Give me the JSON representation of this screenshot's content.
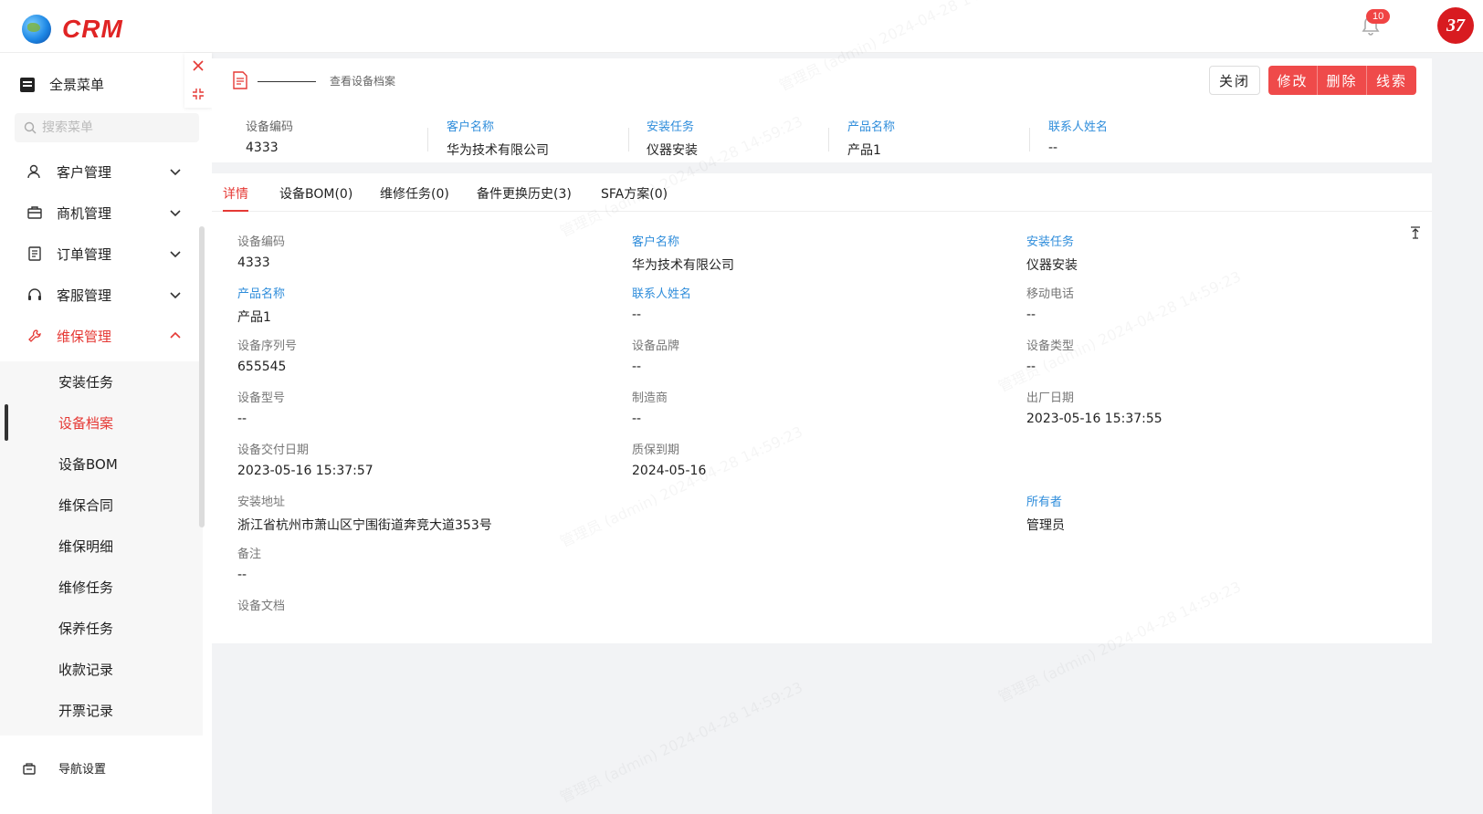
{
  "app": {
    "logo_text": "CRM",
    "notification_count": "10",
    "avatar_text": "37"
  },
  "sidebar": {
    "full_menu_label": "全景菜单",
    "search_placeholder": "搜索菜单",
    "items": [
      {
        "label": "客户管理",
        "icon": "user-icon"
      },
      {
        "label": "商机管理",
        "icon": "briefcase-icon"
      },
      {
        "label": "订单管理",
        "icon": "document-icon"
      },
      {
        "label": "客服管理",
        "icon": "headset-icon"
      },
      {
        "label": "维保管理",
        "icon": "wrench-icon",
        "active": true
      }
    ],
    "submenu": [
      "安装任务",
      "设备档案",
      "设备BOM",
      "维保合同",
      "维保明细",
      "维修任务",
      "保养任务",
      "收款记录",
      "开票记录"
    ],
    "active_sub": "设备档案",
    "settings_label": "导航设置"
  },
  "header": {
    "title": "查看设备档案",
    "buttons": {
      "close": "关闭",
      "edit": "修改",
      "delete": "删除",
      "lead": "线索"
    }
  },
  "summary": [
    {
      "label": "设备编码",
      "value": "4333"
    },
    {
      "label": "客户名称",
      "value": "华为技术有限公司"
    },
    {
      "label": "安装任务",
      "value": "仪器安装"
    },
    {
      "label": "产品名称",
      "value": "产品1"
    },
    {
      "label": "联系人姓名",
      "value": "--"
    }
  ],
  "tabs": [
    "详情",
    "设备BOM(0)",
    "维修任务(0)",
    "备件更换历史(3)",
    "SFA方案(0)"
  ],
  "details": {
    "device_code": {
      "label": "设备编码",
      "value": "4333"
    },
    "customer": {
      "label": "客户名称",
      "value": "华为技术有限公司"
    },
    "install_task": {
      "label": "安装任务",
      "value": "仪器安装"
    },
    "product": {
      "label": "产品名称",
      "value": "产品1"
    },
    "contact": {
      "label": "联系人姓名",
      "value": "--"
    },
    "mobile": {
      "label": "移动电话",
      "value": "--"
    },
    "serial": {
      "label": "设备序列号",
      "value": "655545"
    },
    "brand": {
      "label": "设备品牌",
      "value": "--"
    },
    "device_type": {
      "label": "设备类型",
      "value": "--"
    },
    "model": {
      "label": "设备型号",
      "value": "--"
    },
    "manufacturer": {
      "label": "制造商",
      "value": "--"
    },
    "factory_date": {
      "label": "出厂日期",
      "value": "2023-05-16 15:37:55"
    },
    "delivery_date": {
      "label": "设备交付日期",
      "value": "2023-05-16 15:37:57"
    },
    "warranty": {
      "label": "质保到期",
      "value": "2024-05-16"
    },
    "address": {
      "label": "安装地址",
      "value": "浙江省杭州市萧山区宁围街道奔竞大道353号"
    },
    "owner": {
      "label": "所有者",
      "value": "管理员"
    },
    "remark": {
      "label": "备注",
      "value": "--"
    },
    "documents": {
      "label": "设备文档"
    }
  },
  "watermark_text": "管理员 (admin) 2024-04-28 14:59:23",
  "colors": {
    "accent": "#e53935",
    "link_blue": "#2f8ddb",
    "button_red": "#ef4a4a"
  }
}
